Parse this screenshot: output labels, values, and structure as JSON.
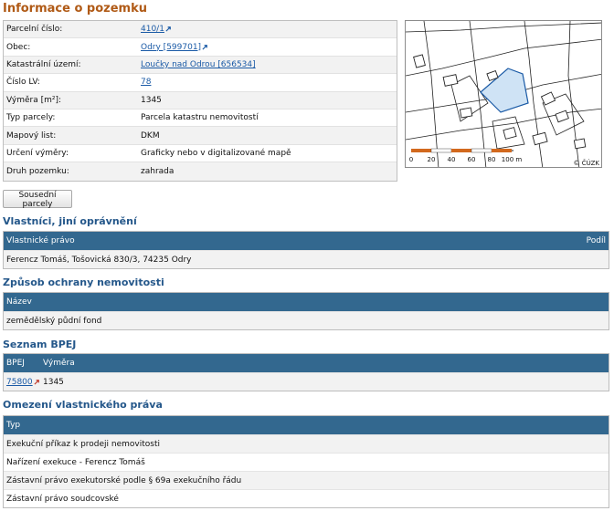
{
  "title": "Informace o pozemku",
  "info": {
    "rows": [
      {
        "label": "Parcelní číslo:",
        "value": "410/1",
        "link": true,
        "ext": true
      },
      {
        "label": "Obec:",
        "value": "Odry [599701]",
        "link": true,
        "ext": true
      },
      {
        "label": "Katastrální území:",
        "value": "Loučky nad Odrou [656534]",
        "link": true,
        "ext": false
      },
      {
        "label": "Číslo LV:",
        "value": "78",
        "link": true,
        "ext": false
      },
      {
        "label": "Výměra [m²]:",
        "value": "1345",
        "link": false
      },
      {
        "label": "Typ parcely:",
        "value": "Parcela katastru nemovitostí",
        "link": false
      },
      {
        "label": "Mapový list:",
        "value": "DKM",
        "link": false
      },
      {
        "label": "Určení výměry:",
        "value": "Graficky nebo v digitalizované mapě",
        "link": false
      },
      {
        "label": "Druh pozemku:",
        "value": "zahrada",
        "link": false
      }
    ]
  },
  "map": {
    "scale_labels": [
      "0",
      "20",
      "40",
      "60",
      "80",
      "100 m"
    ],
    "copyright": "© ČÚZK"
  },
  "buttons": {
    "neighbors": "Sousední parcely"
  },
  "owners": {
    "heading": "Vlastníci, jiní oprávnění",
    "col1": "Vlastnické právo",
    "col2": "Podíl",
    "rows": [
      "Ferencz Tomáš, Tošovická 830/3, 74235 Odry"
    ]
  },
  "protection": {
    "heading": "Způsob ochrany nemovitosti",
    "col1": "Název",
    "rows": [
      "zemědělský půdní fond"
    ]
  },
  "bpej": {
    "heading": "Seznam BPEJ",
    "col1": "BPEJ",
    "col2": "Výměra",
    "rows": [
      {
        "code": "75800",
        "area": "1345"
      }
    ]
  },
  "restrictions": {
    "heading": "Omezení vlastnického práva",
    "col1": "Typ",
    "rows": [
      "Exekuční příkaz k prodeji nemovitosti",
      "Nařízení exekuce - Ferencz Tomáš",
      "Zástavní právo exekutorské podle § 69a exekučního řádu",
      "Zástavní právo soudcovské"
    ]
  },
  "colors": {
    "heading": "#b05a16",
    "section": "#24578a",
    "table_header": "#33688f",
    "link": "#1a5aa6",
    "parcel_fill": "#cfe3f5"
  }
}
